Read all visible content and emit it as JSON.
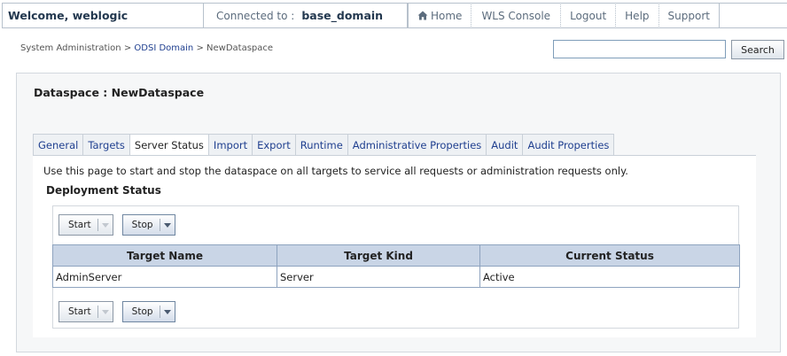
{
  "header": {
    "welcome": "Welcome, weblogic",
    "connected_label": "Connected to :",
    "domain": "base_domain",
    "links": [
      "Home",
      "WLS Console",
      "Logout",
      "Help",
      "Support"
    ]
  },
  "breadcrumb": {
    "root": "System Administration",
    "sep1": " > ",
    "domain": "ODSI Domain",
    "sep2": "  > ",
    "current": "NewDataspace"
  },
  "search": {
    "value": "",
    "button": "Search"
  },
  "panel": {
    "title": "Dataspace : NewDataspace"
  },
  "tabs": [
    "General",
    "Targets",
    "Server Status",
    "Import",
    "Export",
    "Runtime",
    "Administrative Properties",
    "Audit",
    "Audit Properties"
  ],
  "active_tab": "Server Status",
  "content": {
    "description": "Use this page to start and stop the dataspace on all targets to service all requests or administration requests only.",
    "section_title": "Deployment Status",
    "start_label": "Start",
    "stop_label": "Stop",
    "columns": [
      "Target Name",
      "Target Kind",
      "Current Status"
    ],
    "rows": [
      [
        "AdminServer",
        "Server",
        "Active"
      ]
    ]
  }
}
